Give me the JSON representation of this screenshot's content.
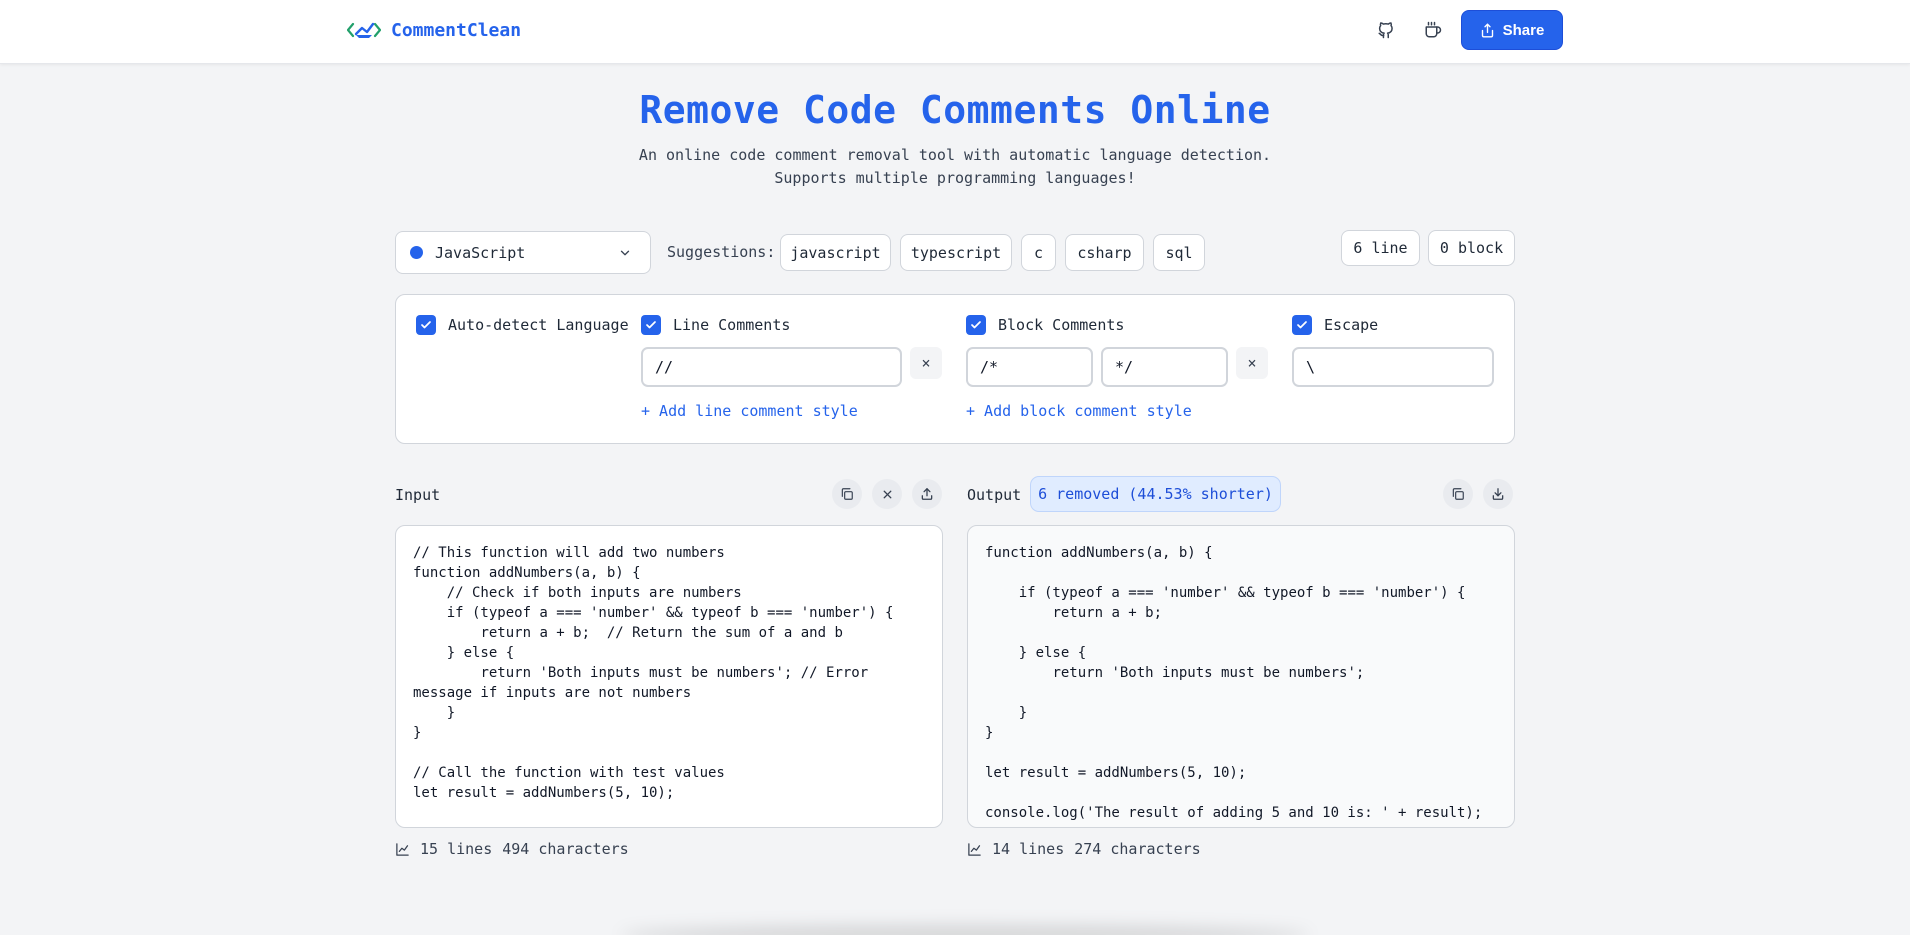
{
  "header": {
    "app_name": "CommentClean",
    "share_label": "Share",
    "icons": [
      "github-icon",
      "coffee-icon",
      "share-icon"
    ]
  },
  "hero": {
    "title": "Remove Code Comments Online",
    "subtitle": "An online code comment removal tool with automatic language detection. Supports multiple programming languages!"
  },
  "language": {
    "selected": "JavaScript",
    "suggestions_label": "Suggestions:",
    "suggestions": [
      "javascript",
      "typescript",
      "c",
      "csharp",
      "sql"
    ]
  },
  "counts": {
    "line": "6 line",
    "block": "0 block"
  },
  "options": {
    "auto_detect": {
      "label": "Auto-detect Language",
      "checked": true
    },
    "line_comments": {
      "label": "Line Comments",
      "checked": true,
      "values": [
        "//"
      ],
      "add_label": "+ Add line comment style"
    },
    "block_comments": {
      "label": "Block Comments",
      "checked": true,
      "start": "/*",
      "end": "*/",
      "add_label": "+ Add block comment style"
    },
    "escape": {
      "label": "Escape",
      "checked": true,
      "value": "\\"
    },
    "remove_symbol": "×"
  },
  "input": {
    "label": "Input",
    "code": "// This function will add two numbers\nfunction addNumbers(a, b) {\n    // Check if both inputs are numbers\n    if (typeof a === 'number' && typeof b === 'number') {\n        return a + b;  // Return the sum of a and b\n    } else {\n        return 'Both inputs must be numbers'; // Error message if inputs are not numbers\n    }\n}\n\n// Call the function with test values\nlet result = addNumbers(5, 10);",
    "lines": "15 lines",
    "characters": "494 characters"
  },
  "output": {
    "label": "Output",
    "badge": "6 removed (44.53% shorter)",
    "code": "function addNumbers(a, b) {\n\n    if (typeof a === 'number' && typeof b === 'number') {\n        return a + b;\n\n    } else {\n        return 'Both inputs must be numbers';\n\n    }\n}\n\nlet result = addNumbers(5, 10);\n\nconsole.log('The result of adding 5 and 10 is: ' + result);",
    "lines": "14 lines",
    "characters": "274 characters"
  },
  "colors": {
    "accent": "#2563eb",
    "background": "#f3f4f6",
    "border": "#d1d5db"
  }
}
